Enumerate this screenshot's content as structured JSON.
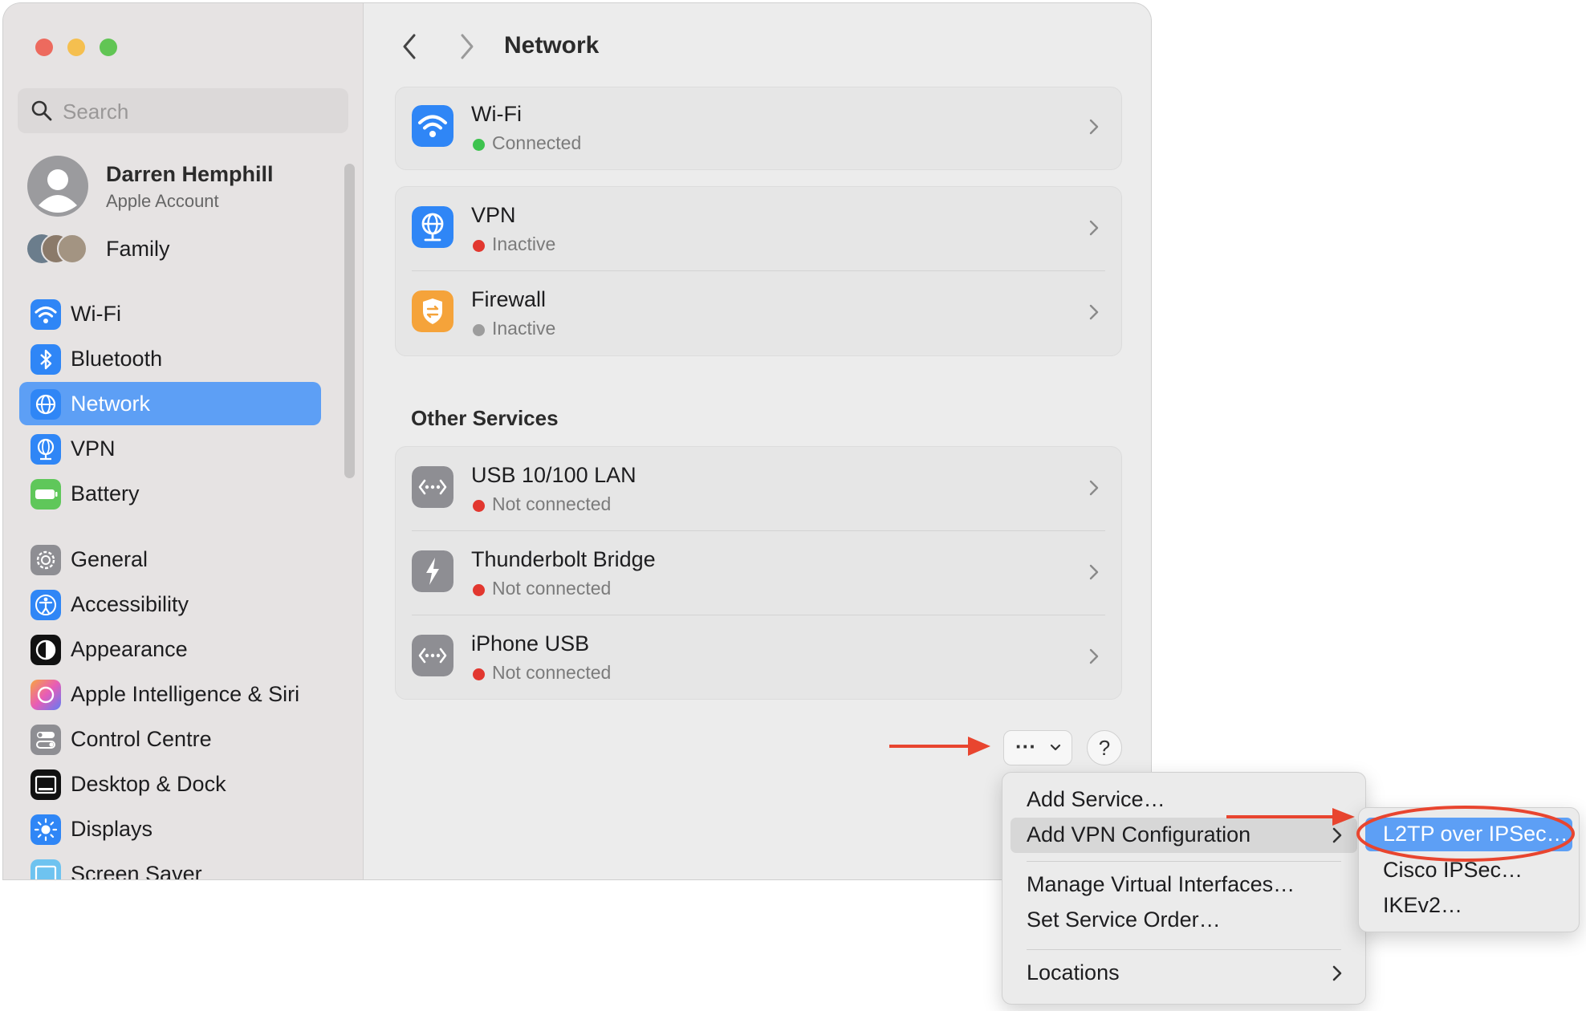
{
  "window": {
    "title": "Network",
    "colors": {
      "close": "#ed6a5e",
      "minimize": "#f5bf4f",
      "zoom": "#61c554",
      "accent": "#5d9ff5"
    }
  },
  "sidebar": {
    "search_placeholder": "Search",
    "account": {
      "name": "Darren Hemphill",
      "subtitle": "Apple Account"
    },
    "family_label": "Family",
    "items": [
      {
        "label": "Wi-Fi",
        "icon": "wifi-icon"
      },
      {
        "label": "Bluetooth",
        "icon": "bluetooth-icon"
      },
      {
        "label": "Network",
        "icon": "globe-icon",
        "selected": true
      },
      {
        "label": "VPN",
        "icon": "vpn-icon"
      },
      {
        "label": "Battery",
        "icon": "battery-icon"
      },
      {
        "label": "General",
        "icon": "gear-icon"
      },
      {
        "label": "Accessibility",
        "icon": "accessibility-icon"
      },
      {
        "label": "Appearance",
        "icon": "appearance-icon"
      },
      {
        "label": "Apple Intelligence & Siri",
        "icon": "siri-icon"
      },
      {
        "label": "Control Centre",
        "icon": "control-centre-icon"
      },
      {
        "label": "Desktop & Dock",
        "icon": "dock-icon"
      },
      {
        "label": "Displays",
        "icon": "displays-icon"
      },
      {
        "label": "Screen Saver",
        "icon": "screen-saver-icon"
      }
    ]
  },
  "main": {
    "services": [
      {
        "name": "Wi-Fi",
        "status": "Connected",
        "status_color": "#3dc34e",
        "icon": "wifi-icon"
      },
      {
        "name": "VPN",
        "status": "Inactive",
        "status_color": "#e2372f",
        "icon": "vpn-icon"
      },
      {
        "name": "Firewall",
        "status": "Inactive",
        "status_color": "#9d9d9d",
        "icon": "firewall-icon"
      }
    ],
    "other_services_heading": "Other Services",
    "other_services": [
      {
        "name": "USB 10/100 LAN",
        "status": "Not connected",
        "status_color": "#e2372f",
        "icon": "ethernet-icon"
      },
      {
        "name": "Thunderbolt Bridge",
        "status": "Not connected",
        "status_color": "#e2372f",
        "icon": "thunderbolt-icon"
      },
      {
        "name": "iPhone USB",
        "status": "Not connected",
        "status_color": "#e2372f",
        "icon": "ethernet-icon"
      }
    ],
    "action_button": "···",
    "help_button": "?"
  },
  "context_menu": {
    "items": [
      "Add Service…",
      "Add VPN Configuration",
      "Manage Virtual Interfaces…",
      "Set Service Order…",
      "Locations"
    ]
  },
  "submenu": {
    "items": [
      "L2TP over IPSec…",
      "Cisco IPSec…",
      "IKEv2…"
    ]
  }
}
